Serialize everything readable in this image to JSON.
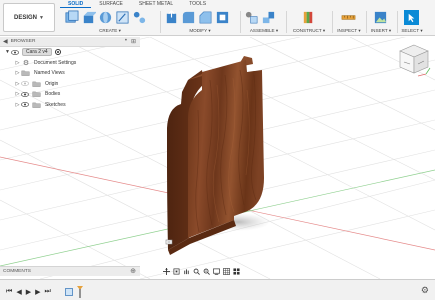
{
  "workspace": {
    "label": "DESIGN"
  },
  "tabs": [
    {
      "label": "SOLID",
      "active": true
    },
    {
      "label": "SURFACE",
      "active": false
    },
    {
      "label": "SHEET METAL",
      "active": false
    },
    {
      "label": "TOOLS",
      "active": false
    }
  ],
  "groups": {
    "create": "CREATE ▾",
    "modify": "MODIFY ▾",
    "assemble": "ASSEMBLE ▾",
    "construct": "CONSTRUCT ▾",
    "inspect": "INSPECT ▾",
    "insert": "INSERT ▾",
    "select": "SELECT ▾"
  },
  "browser": {
    "title": "BROWSER",
    "root": "Cara 2 v4",
    "items": [
      {
        "label": "Document Settings"
      },
      {
        "label": "Named Views"
      },
      {
        "label": "Origin"
      },
      {
        "label": "Bodies"
      },
      {
        "label": "Sketches"
      }
    ]
  },
  "comments": {
    "label": "COMMENTS"
  },
  "colors": {
    "accent": "#0a6cc8",
    "wood": "#7a3d22",
    "axis_red": "#e06b6b",
    "axis_green": "#5fbf5f"
  },
  "icons": [
    "new-component-icon",
    "extrude-icon",
    "revolve-icon",
    "sketch-icon",
    "press-pull-icon",
    "joint-icon",
    "plane-icon",
    "measure-icon",
    "insert-image-icon",
    "select-icon",
    "settings-gear-icon"
  ]
}
